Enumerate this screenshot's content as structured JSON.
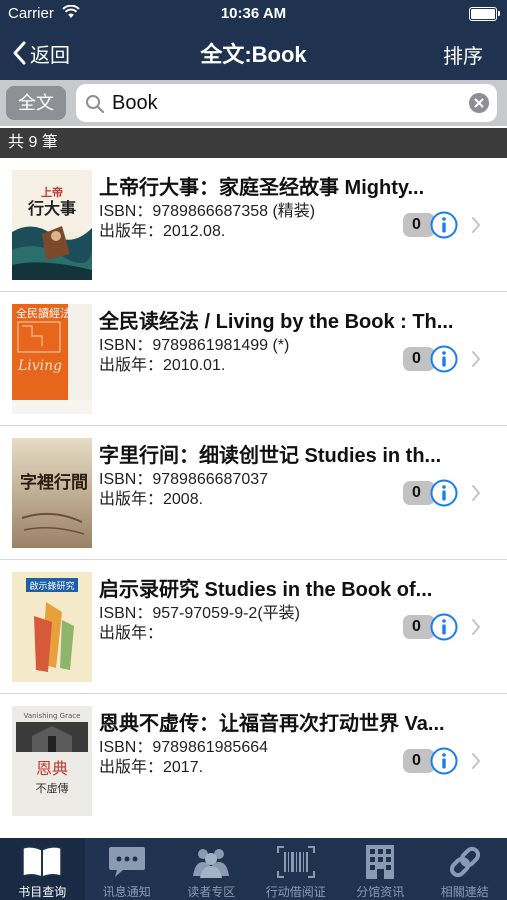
{
  "status_bar": {
    "carrier": "Carrier",
    "time": "10:36 AM"
  },
  "nav": {
    "back_label": "返回",
    "title": "全文:Book",
    "sort_label": "排序"
  },
  "search": {
    "scope_label": "全文",
    "query": "Book"
  },
  "result_count": "共 9 筆",
  "results": [
    {
      "title": "上帝行大事：家庭圣经故事 Mighty...",
      "isbn": "ISBN：9789866687358 (精装)",
      "pub": "出版年：2012.08.",
      "count": "0",
      "cover_text": "上帝行大事"
    },
    {
      "title": "全民读经法 / Living by the Book : Th...",
      "isbn": "ISBN：9789861981499 (*)",
      "pub": "出版年：2010.01.",
      "count": "0",
      "cover_text": "全民讀經法"
    },
    {
      "title": "字里行间：细读创世记 Studies in th...",
      "isbn": "ISBN：9789866687037",
      "pub": "出版年：2008.",
      "count": "0",
      "cover_text": "字裡行間"
    },
    {
      "title": "启示录研究 Studies in the Book of...",
      "isbn": "ISBN：957-97059-9-2(平装)",
      "pub": "出版年：",
      "count": "0",
      "cover_text": "啟示錄研究"
    },
    {
      "title": "恩典不虚传：让福音再次打动世界 Va...",
      "isbn": "ISBN：9789861985664",
      "pub": "出版年：2017.",
      "count": "0",
      "cover_text": "恩典不虛傳",
      "cover_subtext": "Vanishing Grace"
    }
  ],
  "tabs": [
    {
      "label": "书目查询",
      "icon": "book-icon",
      "active": true
    },
    {
      "label": "讯息通知",
      "icon": "chat-bubble-icon",
      "active": false
    },
    {
      "label": "读者专区",
      "icon": "people-icon",
      "active": false
    },
    {
      "label": "行动借阅证",
      "icon": "barcode-icon",
      "active": false
    },
    {
      "label": "分馆资讯",
      "icon": "building-icon",
      "active": false
    },
    {
      "label": "相關連結",
      "icon": "link-icon",
      "active": false
    }
  ],
  "colors": {
    "nav_bg": "#1f3350",
    "info_blue": "#1a7cf0",
    "count_bar": "#3b3b3b"
  }
}
